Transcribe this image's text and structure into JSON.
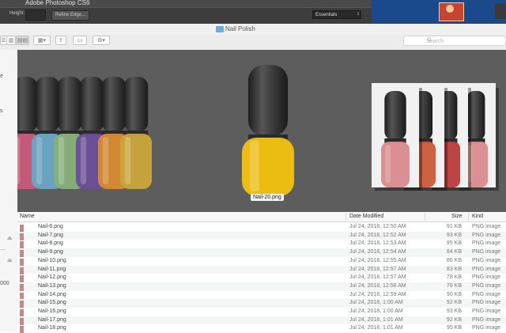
{
  "photoshop": {
    "title": "Adobe Photoshop CS6",
    "height_label": "Height:",
    "refine_edge": "Refine Edge...",
    "workspace": "Essentials"
  },
  "finder": {
    "title": "Nail Polish",
    "search_placeholder": "Search",
    "preview_caption": "Nail-20.png"
  },
  "sidebar": {
    "fragments": [
      "e",
      "s",
      "…",
      "000"
    ]
  },
  "columns": {
    "name": "Name",
    "date": "Date Modified",
    "size": "Size",
    "kind": "Kind"
  },
  "files": [
    {
      "name": "Nail-6.png",
      "date": "Jul 24, 2018, 12:50 AM",
      "size": "91 KB",
      "kind": "PNG image"
    },
    {
      "name": "Nail-7.png",
      "date": "Jul 24, 2018, 12:52 AM",
      "size": "93 KB",
      "kind": "PNG image"
    },
    {
      "name": "Nail-8.png",
      "date": "Jul 24, 2018, 12:53 AM",
      "size": "95 KB",
      "kind": "PNG image"
    },
    {
      "name": "Nail-9.png",
      "date": "Jul 24, 2018, 12:54 AM",
      "size": "84 KB",
      "kind": "PNG image"
    },
    {
      "name": "Nail-10.png",
      "date": "Jul 24, 2018, 12:55 AM",
      "size": "86 KB",
      "kind": "PNG image"
    },
    {
      "name": "Nail-11.png",
      "date": "Jul 24, 2018, 12:57 AM",
      "size": "83 KB",
      "kind": "PNG image"
    },
    {
      "name": "Nail-12.png",
      "date": "Jul 24, 2018, 12:57 AM",
      "size": "78 KB",
      "kind": "PNG image"
    },
    {
      "name": "Nail-13.png",
      "date": "Jul 24, 2018, 12:58 AM",
      "size": "76 KB",
      "kind": "PNG image"
    },
    {
      "name": "Nail-14.png",
      "date": "Jul 24, 2018, 12:59 AM",
      "size": "90 KB",
      "kind": "PNG image"
    },
    {
      "name": "Nail-15.png",
      "date": "Jul 24, 2018, 1:00 AM",
      "size": "92 KB",
      "kind": "PNG image"
    },
    {
      "name": "Nail-16.png",
      "date": "Jul 24, 2018, 1:00 AM",
      "size": "93 KB",
      "kind": "PNG image"
    },
    {
      "name": "Nail-17.png",
      "date": "Jul 24, 2018, 1:01 AM",
      "size": "92 KB",
      "kind": "PNG image"
    },
    {
      "name": "Nail-18.png",
      "date": "Jul 24, 2018, 1:01 AM",
      "size": "95 KB",
      "kind": "PNG image"
    }
  ],
  "colors": {
    "left_bottles": [
      "#c85a7a",
      "#6aa7c4",
      "#87b07a",
      "#6a4e9a",
      "#d98a32",
      "#c9a53a"
    ],
    "center_bottle": "#f2c20f",
    "right_bottles": [
      "#d88a8c",
      "#c85a3a",
      "#b83a3a",
      "#d98a8c"
    ]
  }
}
